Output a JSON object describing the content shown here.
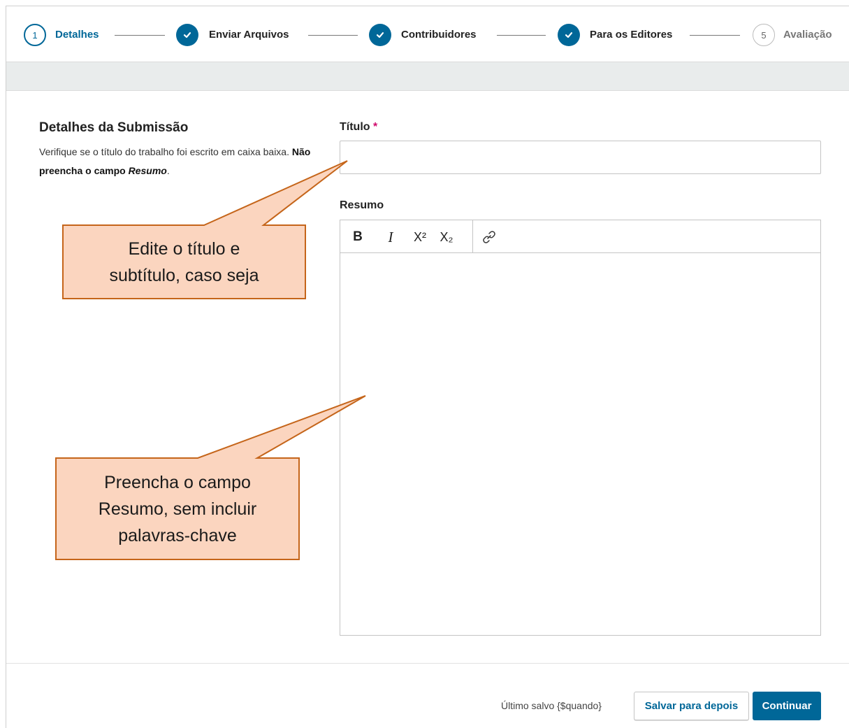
{
  "colors": {
    "primary": "#006798",
    "required": "#d00a6c",
    "callout_fill": "#fbd5bf",
    "callout_border": "#c5651a"
  },
  "stepper": {
    "steps": [
      {
        "number": "1",
        "label": "Detalhes",
        "state": "current"
      },
      {
        "number": "",
        "label": "Enviar Arquivos",
        "state": "done",
        "icon": "check-icon"
      },
      {
        "number": "",
        "label": "Contribuidores",
        "state": "done",
        "icon": "check-icon"
      },
      {
        "number": "",
        "label": "Para os Editores",
        "state": "done",
        "icon": "check-icon"
      },
      {
        "number": "5",
        "label": "Avaliação",
        "state": "future"
      }
    ]
  },
  "section": {
    "title": "Detalhes da Submissão",
    "desc_part1": "Verifique se o título do trabalho foi escrito em caixa baixa. ",
    "desc_bold": "Não preencha o campo ",
    "desc_bold_italic": "Resumo",
    "desc_end": "."
  },
  "form": {
    "title_label": "Título",
    "required_mark": "*",
    "title_value": "",
    "abstract_label": "Resumo",
    "toolbar": [
      {
        "name": "bold-icon",
        "glyph": "B"
      },
      {
        "name": "italic-icon",
        "glyph": "I"
      },
      {
        "name": "superscript-icon",
        "glyph": "X²"
      },
      {
        "name": "subscript-icon",
        "glyph": "X₂"
      },
      {
        "name": "link-icon",
        "glyph": "🔗"
      }
    ]
  },
  "footer": {
    "last_saved": "Último salvo {$quando}",
    "save_later": "Salvar para depois",
    "continue": "Continuar"
  },
  "callouts": [
    {
      "line1": "Edite o título e",
      "line2": "subtítulo, caso seja",
      "line3": ""
    },
    {
      "line1": "Preencha o campo",
      "line2": "Resumo, sem incluir",
      "line3": "palavras-chave"
    }
  ]
}
